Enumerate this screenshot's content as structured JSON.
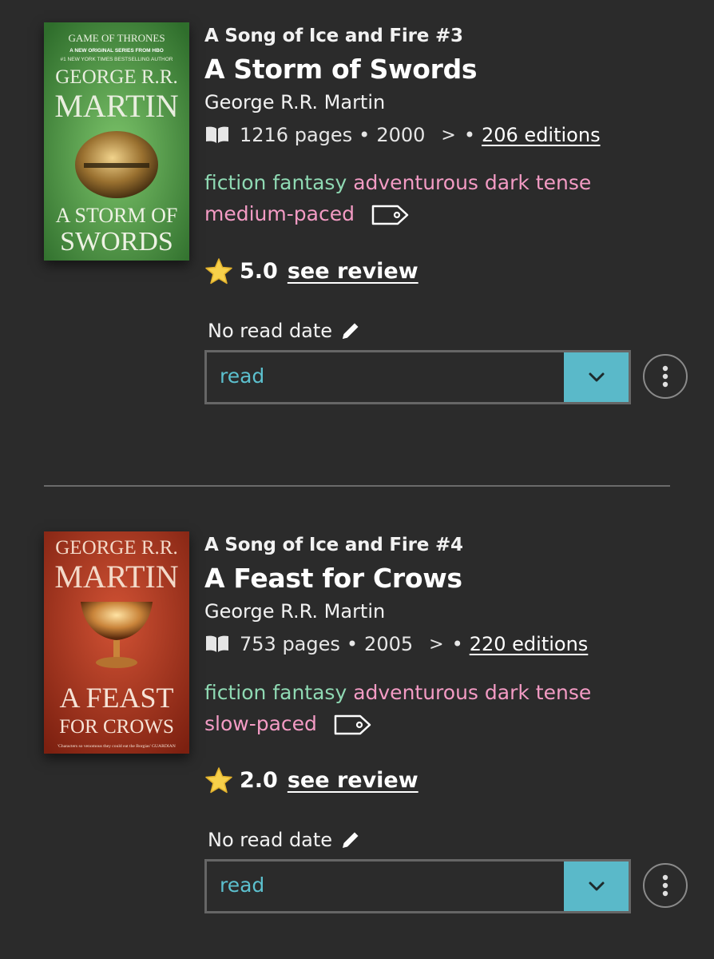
{
  "books": [
    {
      "series": "A Song of Ice and Fire #3",
      "title": "A Storm of Swords",
      "author": "George R.R. Martin",
      "pages": "1216 pages",
      "year": "2000",
      "editions": "206 editions",
      "tags_genre": "fiction fantasy",
      "tags_mood": "adventurous dark tense",
      "tags_pace": "medium-paced",
      "rating": "5.0",
      "review_label": "see review",
      "read_date": "No read date",
      "status": "read",
      "cover": {
        "line1": "GAME OF THRONES",
        "line2": "A NEW ORIGINAL SERIES FROM HBO",
        "line3": "#1 NEW YORK TIMES BESTSELLING AUTHOR",
        "author_top": "GEORGE R.R.",
        "author_bottom": "MARTIN",
        "title_top": "A STORM OF",
        "title_bottom": "SWORDS",
        "color": "#4f9a4a"
      }
    },
    {
      "series": "A Song of Ice and Fire #4",
      "title": "A Feast for Crows",
      "author": "George R.R. Martin",
      "pages": "753 pages",
      "year": "2005",
      "editions": "220 editions",
      "tags_genre": "fiction fantasy",
      "tags_mood": "adventurous dark tense",
      "tags_pace": "slow-paced",
      "rating": "2.0",
      "review_label": "see review",
      "read_date": "No read date",
      "status": "read",
      "cover": {
        "author_top": "GEORGE R.R.",
        "author_bottom": "MARTIN",
        "title_top": "A FEAST",
        "title_bottom": "FOR CROWS",
        "quote": "'Characters so venomous they could eat the Borgias' GUARDIAN",
        "color": "#b63a25"
      }
    }
  ],
  "colors": {
    "background": "#2b2b2b",
    "accent": "#5ab9c9",
    "tag_green": "#8fd9b3",
    "tag_pink": "#f39bc4"
  }
}
